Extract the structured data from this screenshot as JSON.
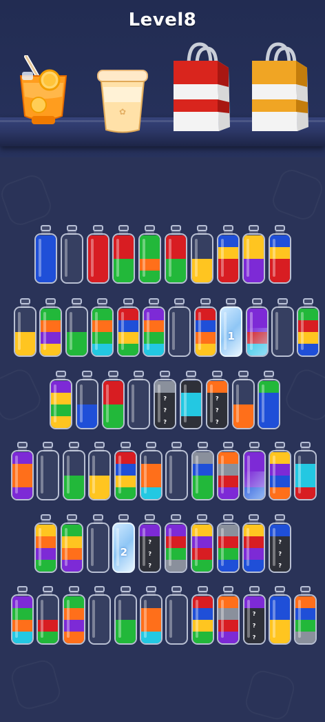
{
  "level_label": "Level8",
  "colors": {
    "blue": "#1f4fd8",
    "red": "#d81d22",
    "green": "#22b83a",
    "yellow": "#ffc520",
    "purple": "#7d2ad6",
    "orange": "#ff6f1a",
    "cyan": "#23c8e2",
    "dark": "#2e3038",
    "gray": "#8a909c",
    "accent_bg": "#2a3358"
  },
  "collectibles": [
    {
      "name": "orange-juice-cup-icon"
    },
    {
      "name": "milkshake-cup-icon"
    },
    {
      "name": "red-shopping-bag-icon"
    },
    {
      "name": "orange-shopping-bag-icon"
    }
  ],
  "rows": [
    [
      {
        "layers": [
          "blue",
          "blue",
          "blue",
          "blue"
        ]
      },
      {
        "layers": []
      },
      {
        "layers": [
          "red",
          "red",
          "red",
          "red"
        ]
      },
      {
        "layers": [
          "green",
          "green",
          "red",
          "red"
        ]
      },
      {
        "layers": [
          "green",
          "orange",
          "green",
          "green"
        ]
      },
      {
        "layers": [
          "green",
          "green",
          "red",
          "red"
        ]
      },
      {
        "layers": [
          "yellow",
          "yellow"
        ]
      },
      {
        "layers": [
          "red",
          "red",
          "yellow",
          "blue"
        ]
      },
      {
        "layers": [
          "purple",
          "purple",
          "yellow",
          "yellow"
        ]
      },
      {
        "layers": [
          "red",
          "red",
          "yellow",
          "blue"
        ]
      }
    ],
    [
      {
        "layers": [
          "yellow",
          "yellow"
        ]
      },
      {
        "layers": [
          "yellow",
          "purple",
          "orange",
          "green"
        ]
      },
      {
        "layers": [
          "green",
          "green"
        ]
      },
      {
        "layers": [
          "cyan",
          "green",
          "orange",
          "green"
        ]
      },
      {
        "layers": [
          "green",
          "yellow",
          "blue",
          "red"
        ]
      },
      {
        "layers": [
          "cyan",
          "green",
          "orange",
          "purple"
        ]
      },
      {
        "layers": []
      },
      {
        "layers": [
          "yellow",
          "orange",
          "blue",
          "red"
        ]
      },
      {
        "ice": true,
        "number": "1"
      },
      {
        "layers": [
          "cyan",
          "red",
          "purple",
          "purple"
        ],
        "melting": true
      },
      {
        "layers": []
      },
      {
        "layers": [
          "blue",
          "yellow",
          "red",
          "green"
        ]
      }
    ],
    [
      {
        "layers": [
          "yellow",
          "green",
          "yellow",
          "purple"
        ]
      },
      {
        "layers": [
          "blue",
          "blue"
        ]
      },
      {
        "layers": [
          "green",
          "green",
          "red",
          "red"
        ]
      },
      {
        "layers": []
      },
      {
        "layers": [
          "dark",
          "dark",
          "dark",
          "gray"
        ],
        "hidden": true
      },
      {
        "layers": [
          "dark",
          "cyan",
          "cyan",
          "dark"
        ]
      },
      {
        "layers": [
          "dark",
          "dark",
          "dark",
          "orange"
        ],
        "hidden": true
      },
      {
        "layers": [
          "orange",
          "orange"
        ]
      },
      {
        "layers": [
          "blue",
          "blue",
          "blue",
          "green"
        ]
      }
    ],
    [
      {
        "layers": [
          "purple",
          "orange",
          "orange",
          "purple"
        ]
      },
      {
        "layers": []
      },
      {
        "layers": [
          "green",
          "green"
        ]
      },
      {
        "layers": [
          "yellow",
          "yellow"
        ]
      },
      {
        "layers": [
          "green",
          "yellow",
          "blue",
          "red"
        ]
      },
      {
        "layers": [
          "cyan",
          "orange",
          "orange"
        ]
      },
      {
        "layers": []
      },
      {
        "layers": [
          "green",
          "green",
          "blue",
          "gray"
        ]
      },
      {
        "layers": [
          "purple",
          "red",
          "gray",
          "orange"
        ]
      },
      {
        "layers": [
          "blue",
          "purple",
          "purple",
          "purple"
        ],
        "melting": true
      },
      {
        "layers": [
          "orange",
          "blue",
          "purple",
          "yellow"
        ]
      },
      {
        "layers": [
          "red",
          "cyan",
          "cyan"
        ]
      }
    ],
    [
      {
        "layers": [
          "green",
          "purple",
          "orange",
          "yellow"
        ]
      },
      {
        "layers": [
          "purple",
          "orange",
          "yellow",
          "green"
        ]
      },
      {
        "layers": []
      },
      {
        "ice": true,
        "number": "2"
      },
      {
        "layers": [
          "dark",
          "dark",
          "dark",
          "purple"
        ],
        "hidden": true
      },
      {
        "layers": [
          "gray",
          "green",
          "red",
          "purple"
        ]
      },
      {
        "layers": [
          "green",
          "red",
          "purple",
          "yellow"
        ]
      },
      {
        "layers": [
          "blue",
          "green",
          "red",
          "gray"
        ]
      },
      {
        "layers": [
          "blue",
          "purple",
          "red",
          "yellow"
        ]
      },
      {
        "layers": [
          "dark",
          "dark",
          "dark",
          "blue"
        ],
        "hidden": true
      }
    ],
    [
      {
        "layers": [
          "cyan",
          "orange",
          "green",
          "purple"
        ]
      },
      {
        "layers": [
          "green",
          "red"
        ]
      },
      {
        "layers": [
          "orange",
          "purple",
          "orange",
          "green"
        ]
      },
      {
        "layers": []
      },
      {
        "layers": [
          "green",
          "green"
        ]
      },
      {
        "layers": [
          "cyan",
          "orange",
          "orange"
        ]
      },
      {
        "layers": []
      },
      {
        "layers": [
          "green",
          "yellow",
          "blue",
          "red"
        ]
      },
      {
        "layers": [
          "purple",
          "red",
          "gray",
          "orange"
        ]
      },
      {
        "layers": [
          "dark",
          "dark",
          "dark",
          "purple"
        ],
        "hidden": true
      },
      {
        "layers": [
          "yellow",
          "yellow",
          "blue",
          "blue"
        ]
      },
      {
        "layers": [
          "gray",
          "green",
          "blue",
          "orange"
        ]
      }
    ]
  ]
}
